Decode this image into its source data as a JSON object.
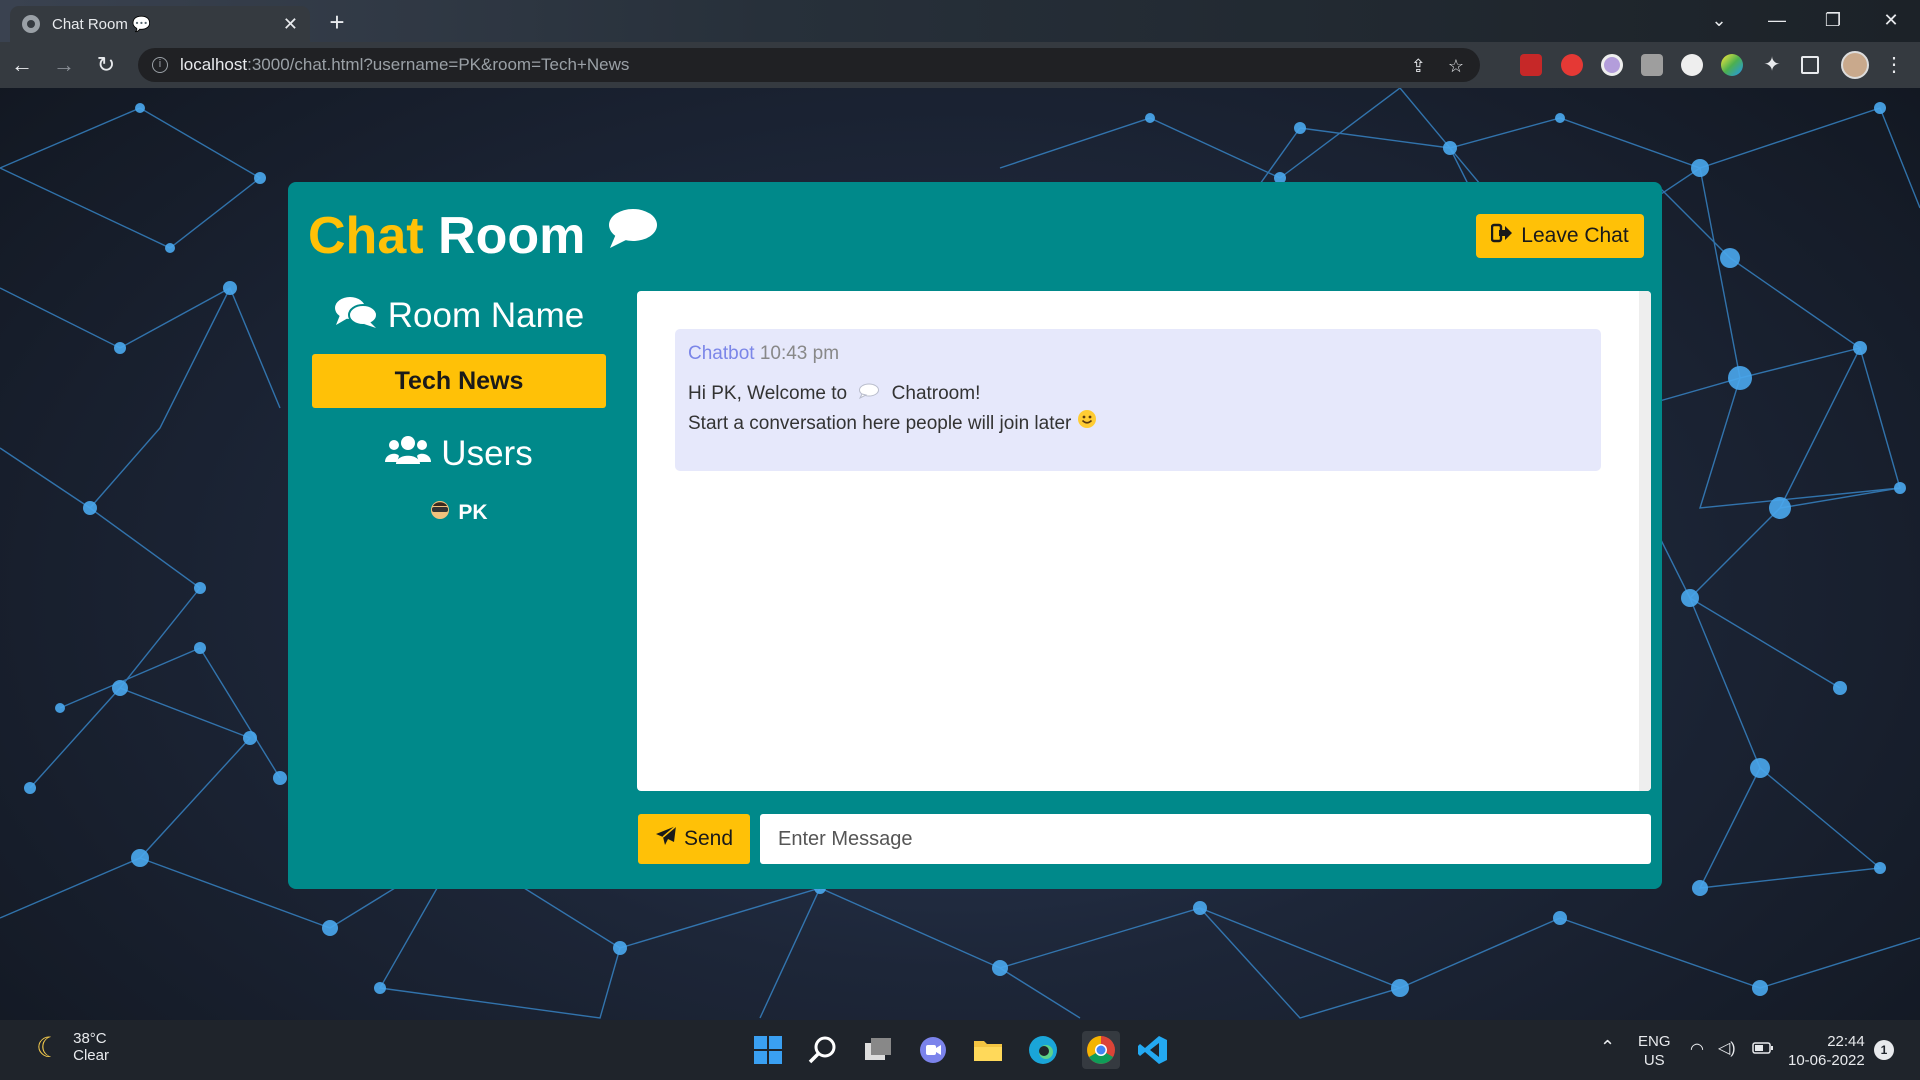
{
  "browser": {
    "tab_title": "Chat Room 💬",
    "tab_close": "✕",
    "new_tab": "+",
    "url_host": "localhost",
    "url_rest": ":3000/chat.html?username=PK&room=Tech+News"
  },
  "app": {
    "title_word1": "Chat",
    "title_word2": "Room",
    "leave_label": "Leave Chat",
    "room_heading": "Room Name",
    "room_name": "Tech News",
    "users_heading": "Users",
    "users": [
      "PK"
    ]
  },
  "messages": [
    {
      "sender": "Chatbot",
      "time": "10:43 pm",
      "line1_pre": "Hi PK, Welcome to",
      "line1_post": "Chatroom!",
      "line2": "Start a conversation here people will join later"
    }
  ],
  "form": {
    "send_label": "Send",
    "placeholder": "Enter Message"
  },
  "taskbar": {
    "temperature": "38°C",
    "condition": "Clear",
    "lang1": "ENG",
    "lang2": "US",
    "time": "22:44",
    "date": "10-06-2022",
    "notifications": "1"
  },
  "colors": {
    "teal": "#00898a",
    "accent": "#ffc107",
    "message_bg": "#e6e8fb",
    "sender": "#7b86e8"
  }
}
